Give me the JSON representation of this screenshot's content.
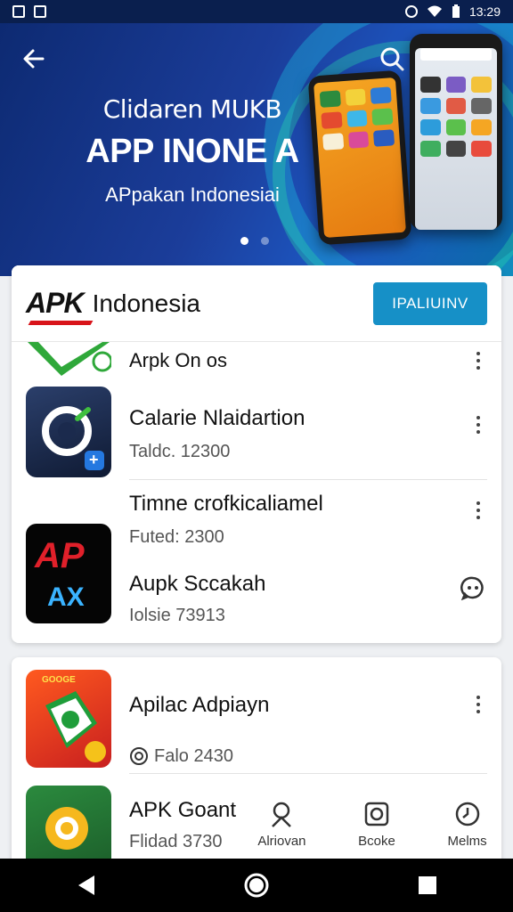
{
  "status": {
    "time": "13:29"
  },
  "hero": {
    "subtitle1": "Clidaren MUKB",
    "title": "APP INONE A",
    "subtitle2": "APpakan Indonesiai"
  },
  "header": {
    "logo_apk": "APK",
    "logo_name": "Indonesia",
    "install_label": "IPALIUINV"
  },
  "apps": [
    {
      "title": "Arpk On os",
      "meta": ""
    },
    {
      "title": "Calarie Nlaidartion",
      "meta": "Taldc. 12300"
    },
    {
      "title": "Timne crofkicaliamel",
      "meta": "Futed: 2300"
    },
    {
      "title": "Aupk Sccakah",
      "meta": "Iolsie 73913"
    },
    {
      "title": "Apilac Adpiayn",
      "meta": "Falo 2430"
    },
    {
      "title": "APK Goant",
      "meta": "Flidad 3730"
    }
  ],
  "icons": {
    "app2_badge": "+",
    "app3_top": "AP",
    "app3_bottom": "AX",
    "app4_label": "GOOGE"
  },
  "tabs": [
    {
      "label": "Alriovan",
      "icon": "person-icon"
    },
    {
      "label": "Bcoke",
      "icon": "bookmark-icon"
    },
    {
      "label": "Melms",
      "icon": "clock-icon"
    }
  ],
  "colors": {
    "accent": "#1690c7",
    "hero": "#1b3d9a",
    "logo_red": "#d8141a"
  }
}
